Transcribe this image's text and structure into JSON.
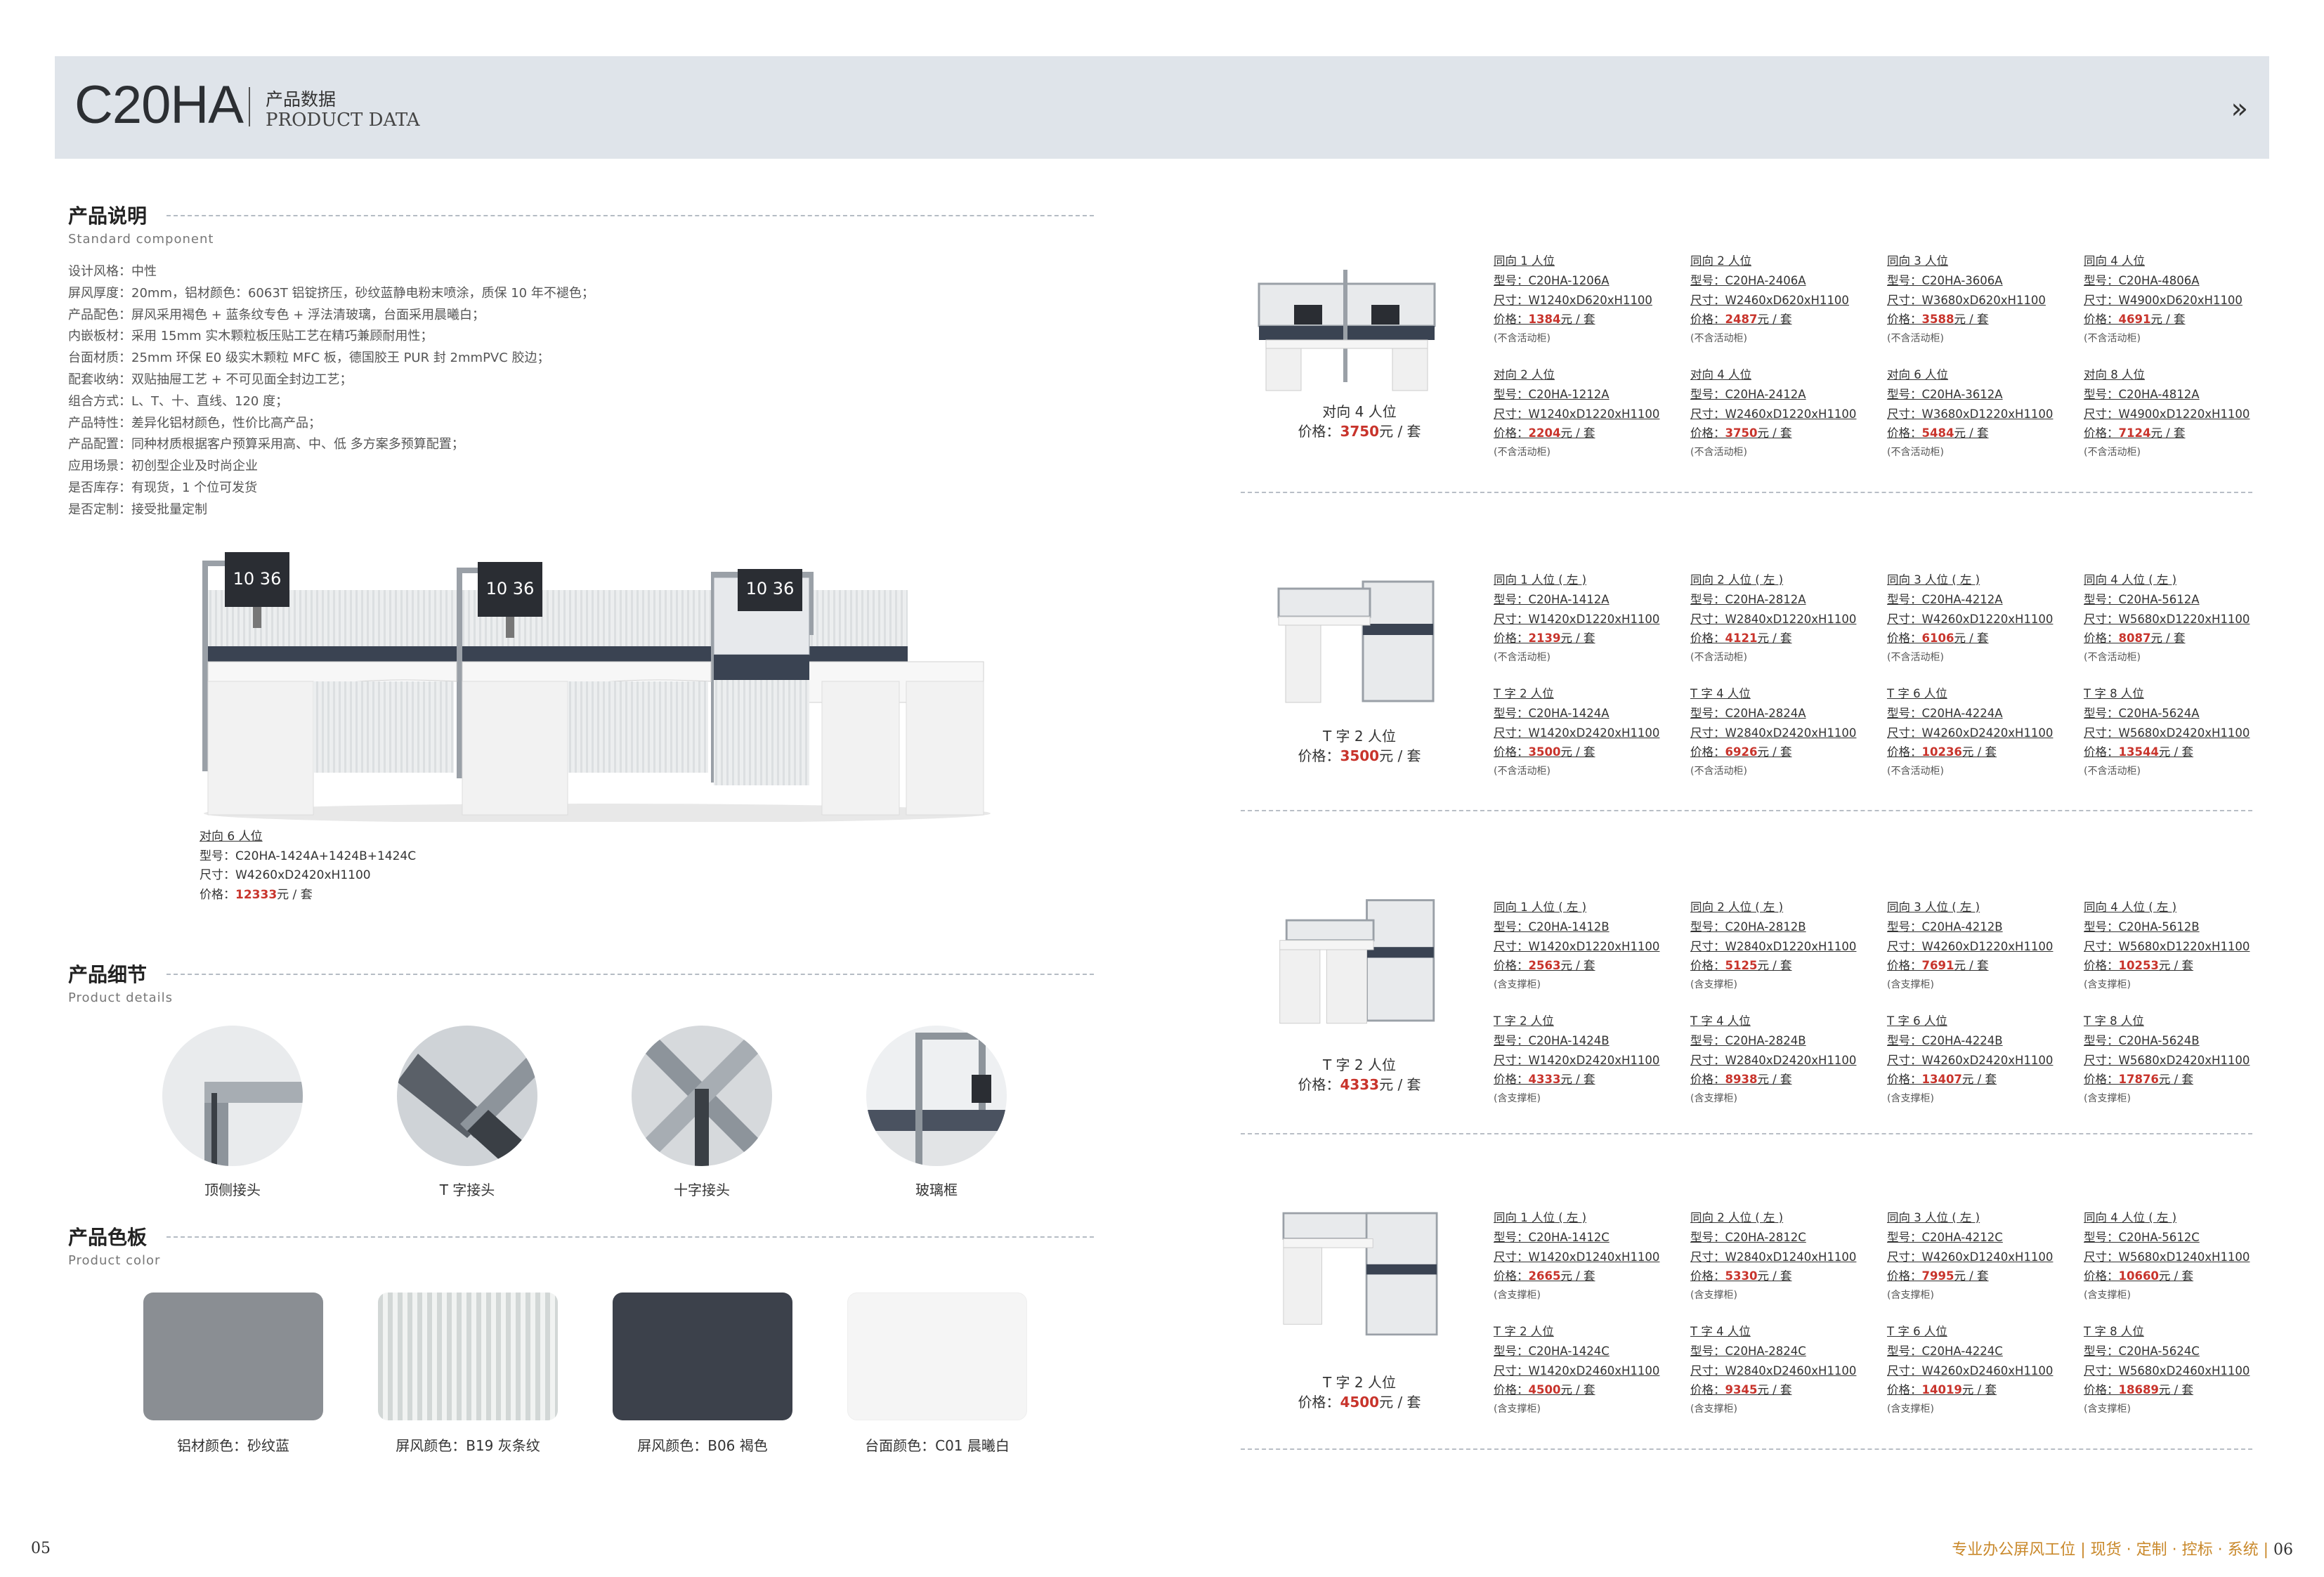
{
  "header": {
    "model": "C20HA",
    "title_cn": "产品数据",
    "title_en": "PRODUCT DATA",
    "chevron": "»"
  },
  "description": {
    "title": "产品说明",
    "subtitle": "Standard component",
    "lines": [
      "设计风格：中性",
      "屏风厚度：20mm，铝材颜色：6063T 铝锭挤压，砂纹蓝静电粉末喷涂，质保 10 年不褪色；",
      "产品配色：屏风采用褐色 + 蓝条纹专色 + 浮法清玻璃，台面采用晨曦白；",
      "内嵌板材：采用 15mm 实木颗粒板压贴工艺在精巧兼顾耐用性；",
      "台面材质：25mm 环保 E0 级实木颗粒 MFC 板，德国胶王 PUR 封 2mmPVC 胶边；",
      "配套收纳：双贴抽屉工艺 + 不可见面全封边工艺；",
      "组合方式：L、T、十、直线、120 度；",
      "产品特性：差异化铝材颜色，性价比高产品；",
      "产品配置：同种材质根据客户预算采用高、中、低 多方案多预算配置；",
      "应用场景：初创型企业及时尚企业",
      "是否库存：有现货，1 个位可发货",
      "是否定制：接受批量定制"
    ]
  },
  "featured": {
    "name": "对向 6 人位",
    "model_label": "型号：",
    "model": "C20HA-1424A+1424B+1424C",
    "size_label": "尺寸：",
    "size": "W4260xD2420xH1100",
    "price_label": "价格：",
    "price": "12333",
    "unit": "元 / 套",
    "monitor_time": "10 36"
  },
  "details": {
    "title": "产品细节",
    "subtitle": "Product details",
    "items": [
      {
        "label": "顶侧接头"
      },
      {
        "label": "T 字接头"
      },
      {
        "label": "十字接头"
      },
      {
        "label": "玻璃框"
      }
    ]
  },
  "colors": {
    "title": "产品色板",
    "subtitle": "Product color",
    "items": [
      {
        "label": "铝材颜色：砂纹蓝",
        "color": "#8a8e93"
      },
      {
        "label": "屏风颜色：B19 灰条纹",
        "color": "#dfe3e2"
      },
      {
        "label": "屏风颜色：B06 褐色",
        "color": "#3c414b"
      },
      {
        "label": "台面颜色：C01 晨曦白",
        "color": "#f5f5f5"
      }
    ]
  },
  "groups": [
    {
      "caption": "对向 4 人位",
      "price": "3750",
      "rows": [
        [
          {
            "name": "同向 1 人位",
            "model": "C20HA-1206A",
            "size": "W1240xD620xH1100",
            "price": "1384",
            "note": "(不含活动柜)"
          },
          {
            "name": "同向 2 人位",
            "model": "C20HA-2406A",
            "size": "W2460xD620xH1100",
            "price": "2487",
            "note": "(不含活动柜)"
          },
          {
            "name": "同向 3 人位",
            "model": "C20HA-3606A",
            "size": "W3680xD620xH1100",
            "price": "3588",
            "note": "(不含活动柜)"
          },
          {
            "name": "同向 4 人位",
            "model": "C20HA-4806A",
            "size": "W4900xD620xH1100",
            "price": "4691",
            "note": "(不含活动柜)"
          }
        ],
        [
          {
            "name": "对向 2 人位",
            "model": "C20HA-1212A",
            "size": "W1240xD1220xH1100",
            "price": "2204",
            "note": "(不含活动柜)"
          },
          {
            "name": "对向 4 人位",
            "model": "C20HA-2412A",
            "size": "W2460xD1220xH1100",
            "price": "3750",
            "note": "(不含活动柜)"
          },
          {
            "name": "对向 6 人位",
            "model": "C20HA-3612A",
            "size": "W3680xD1220xH1100",
            "price": "5484",
            "note": "(不含活动柜)"
          },
          {
            "name": "对向 8 人位",
            "model": "C20HA-4812A",
            "size": "W4900xD1220xH1100",
            "price": "7124",
            "note": "(不含活动柜)"
          }
        ]
      ]
    },
    {
      "caption": "T 字 2 人位",
      "price": "3500",
      "rows": [
        [
          {
            "name": "同向 1 人位 ( 左 )",
            "model": "C20HA-1412A",
            "size": "W1420xD1220xH1100",
            "price": "2139",
            "note": "(不含活动柜)"
          },
          {
            "name": "同向 2 人位 ( 左 )",
            "model": "C20HA-2812A",
            "size": "W2840xD1220xH1100",
            "price": "4121",
            "note": "(不含活动柜)"
          },
          {
            "name": "同向 3 人位 ( 左 )",
            "model": "C20HA-4212A",
            "size": "W4260xD1220xH1100",
            "price": "6106",
            "note": "(不含活动柜)"
          },
          {
            "name": "同向 4 人位 ( 左 )",
            "model": "C20HA-5612A",
            "size": "W5680xD1220xH1100",
            "price": "8087",
            "note": "(不含活动柜)"
          }
        ],
        [
          {
            "name": "T 字 2 人位",
            "model": "C20HA-1424A",
            "size": "W1420xD2420xH1100",
            "price": "3500",
            "note": "(不含活动柜)"
          },
          {
            "name": "T 字 4 人位",
            "model": "C20HA-2824A",
            "size": "W2840xD2420xH1100",
            "price": "6926",
            "note": "(不含活动柜)"
          },
          {
            "name": "T 字 6 人位",
            "model": "C20HA-4224A",
            "size": "W4260xD2420xH1100",
            "price": "10236",
            "note": "(不含活动柜)"
          },
          {
            "name": "T 字 8 人位",
            "model": "C20HA-5624A",
            "size": "W5680xD2420xH1100",
            "price": "13544",
            "note": "(不含活动柜)"
          }
        ]
      ]
    },
    {
      "caption": "T 字 2 人位",
      "price": "4333",
      "rows": [
        [
          {
            "name": "同向 1 人位 ( 左 )",
            "model": "C20HA-1412B",
            "size": "W1420xD1220xH1100",
            "price": "2563",
            "note": "(含支撑柜)"
          },
          {
            "name": "同向 2 人位 ( 左 )",
            "model": "C20HA-2812B",
            "size": "W2840xD1220xH1100",
            "price": "5125",
            "note": "(含支撑柜)"
          },
          {
            "name": "同向 3 人位 ( 左 )",
            "model": "C20HA-4212B",
            "size": "W4260xD1220xH1100",
            "price": "7691",
            "note": "(含支撑柜)"
          },
          {
            "name": "同向 4 人位 ( 左 )",
            "model": "C20HA-5612B",
            "size": "W5680xD1220xH1100",
            "price": "10253",
            "note": "(含支撑柜)"
          }
        ],
        [
          {
            "name": "T 字 2 人位",
            "model": "C20HA-1424B",
            "size": "W1420xD2420xH1100",
            "price": "4333",
            "note": "(含支撑柜)"
          },
          {
            "name": "T 字 4 人位",
            "model": "C20HA-2824B",
            "size": "W2840xD2420xH1100",
            "price": "8938",
            "note": "(含支撑柜)"
          },
          {
            "name": "T 字 6 人位",
            "model": "C20HA-4224B",
            "size": "W4260xD2420xH1100",
            "price": "13407",
            "note": "(含支撑柜)"
          },
          {
            "name": "T 字 8 人位",
            "model": "C20HA-5624B",
            "size": "W5680xD2420xH1100",
            "price": "17876",
            "note": "(含支撑柜)"
          }
        ]
      ]
    },
    {
      "caption": "T 字 2 人位",
      "price": "4500",
      "rows": [
        [
          {
            "name": "同向 1 人位 ( 左 )",
            "model": "C20HA-1412C",
            "size": "W1420xD1240xH1100",
            "price": "2665",
            "note": "(含支撑柜)"
          },
          {
            "name": "同向 2 人位 ( 左 )",
            "model": "C20HA-2812C",
            "size": "W2840xD1240xH1100",
            "price": "5330",
            "note": "(含支撑柜)"
          },
          {
            "name": "同向 3 人位 ( 左 )",
            "model": "C20HA-4212C",
            "size": "W4260xD1240xH1100",
            "price": "7995",
            "note": "(含支撑柜)"
          },
          {
            "name": "同向 4 人位 ( 左 )",
            "model": "C20HA-5612C",
            "size": "W5680xD1240xH1100",
            "price": "10660",
            "note": "(含支撑柜)"
          }
        ],
        [
          {
            "name": "T 字 2 人位",
            "model": "C20HA-1424C",
            "size": "W1420xD2460xH1100",
            "price": "4500",
            "note": "(含支撑柜)"
          },
          {
            "name": "T 字 4 人位",
            "model": "C20HA-2824C",
            "size": "W2840xD2460xH1100",
            "price": "9345",
            "note": "(含支撑柜)"
          },
          {
            "name": "T 字 6 人位",
            "model": "C20HA-4224C",
            "size": "W4260xD2460xH1100",
            "price": "14019",
            "note": "(含支撑柜)"
          },
          {
            "name": "T 字 8 人位",
            "model": "C20HA-5624C",
            "size": "W5680xD2460xH1100",
            "price": "18689",
            "note": "(含支撑柜)"
          }
        ]
      ]
    }
  ],
  "labels": {
    "model": "型号：",
    "size": "尺寸：",
    "price": "价格：",
    "unit": "元 / 套"
  },
  "footer": {
    "page_left": "05",
    "tagline": "专业办公屏风工位 | 现货 · 定制 · 控标 · 系统 |",
    "page_right": "06"
  }
}
